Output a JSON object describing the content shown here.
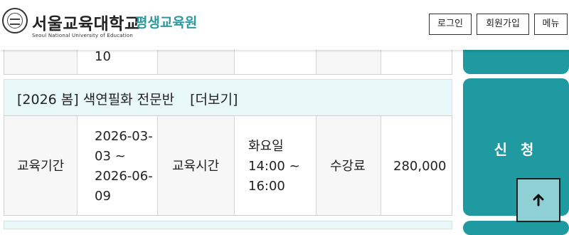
{
  "header": {
    "logo_name": "서울교육대학교",
    "logo_sub": "평생교육원",
    "logo_eng": "Seoul National University of Education",
    "login_label": "로그인",
    "signup_label": "회원가입",
    "menu_label": "메뉴"
  },
  "previous_course": {
    "period_tail": "10"
  },
  "course": {
    "title": "[2026 봄] 색연필화 전문반",
    "more_label": "[더보기]",
    "period_label": "교육기간",
    "period_lines": [
      "2026-03-",
      "03 ~",
      "2026-06-",
      "09"
    ],
    "time_label": "교육시간",
    "time_lines": [
      "화요일",
      "14:00 ~",
      "16:00"
    ],
    "fee_label": "수강료",
    "fee_value": "280,000",
    "apply_label": "신 청"
  },
  "colors": {
    "accent": "#1f9aa1",
    "title_row_bg": "#e8f8f9",
    "top_button_bg": "#8fd0d4"
  },
  "icons": {
    "scroll_top": "arrow-up-icon",
    "logo": "university-emblem-icon"
  }
}
